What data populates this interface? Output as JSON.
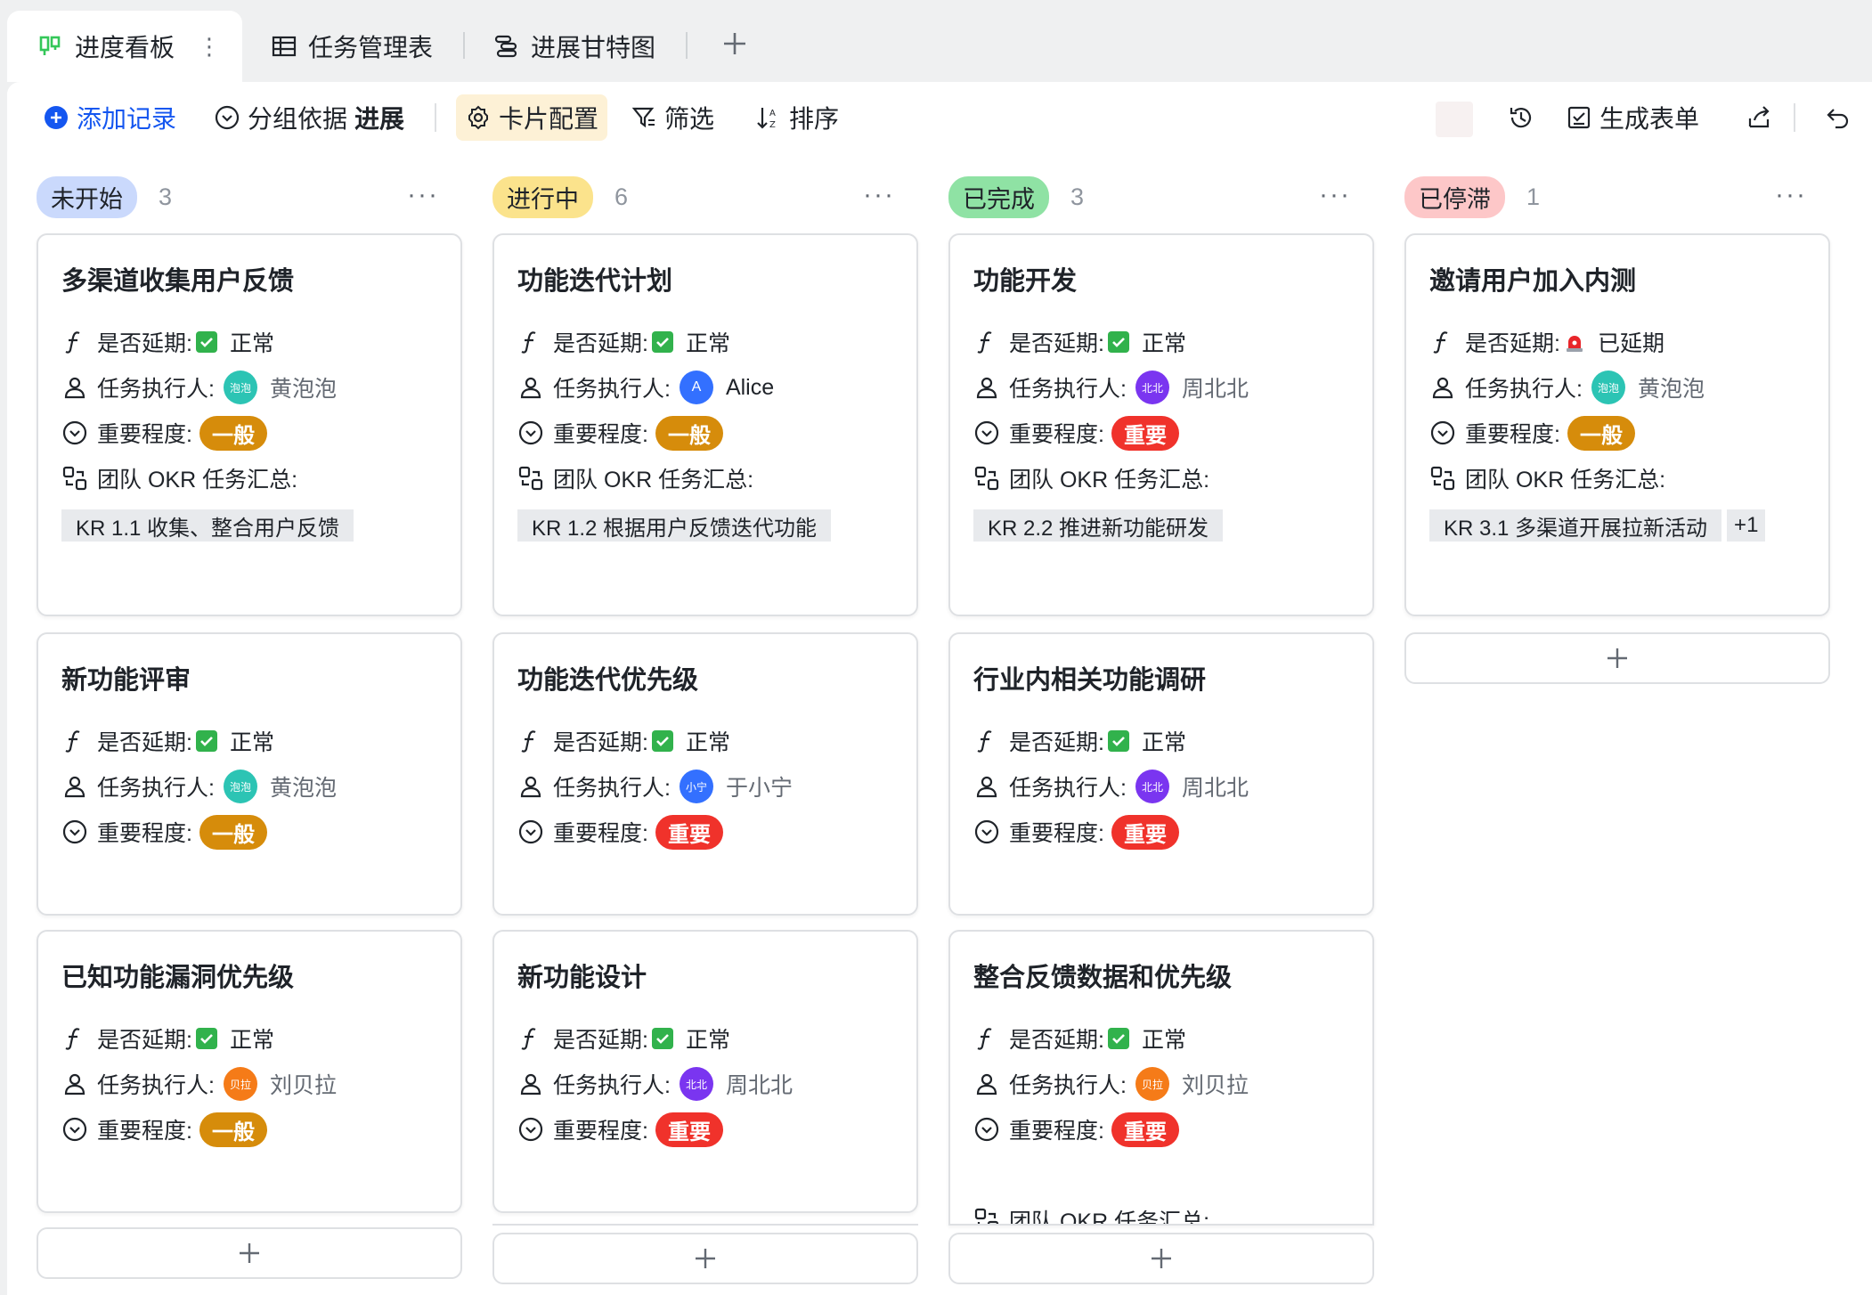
{
  "tabs": [
    {
      "label": "进度看板",
      "icon": "kanban-icon"
    },
    {
      "label": "任务管理表",
      "icon": "table-icon"
    },
    {
      "label": "进展甘特图",
      "icon": "gantt-icon"
    }
  ],
  "toolbar": {
    "add_record": "添加记录",
    "group_prefix": "分组依据",
    "group_field": "进展",
    "card_config": "卡片配置",
    "filter": "筛选",
    "sort": "排序",
    "generate_form": "生成表单"
  },
  "field_labels": {
    "delay": "是否延期:",
    "assignee": "任务执行人:",
    "importance": "重要程度:",
    "okr": "团队 OKR 任务汇总:"
  },
  "colors": {
    "accent": "#1456f0",
    "not_started": "#cad9fc",
    "in_progress": "#fbe38c",
    "done": "#8fe2a4",
    "stalled": "#fdc7c8",
    "importance_normal": "#d68c0b",
    "importance_high": "#f0322b"
  },
  "columns": [
    {
      "status": "未开始",
      "count": "3",
      "cards": [
        {
          "title": "多渠道收集用户反馈",
          "delay": "正常",
          "assignee": "黄泡泡",
          "avatar_text": "泡泡",
          "avatar_color": "#2cc4b4",
          "importance": "一般",
          "okr": [
            "KR 1.1 收集、整合用户反馈"
          ]
        },
        {
          "title": "新功能评审",
          "delay": "正常",
          "assignee": "黄泡泡",
          "avatar_text": "泡泡",
          "avatar_color": "#2cc4b4",
          "importance": "一般"
        },
        {
          "title": "已知功能漏洞优先级",
          "delay": "正常",
          "assignee": "刘贝拉",
          "avatar_text": "贝拉",
          "avatar_color": "#f57b18",
          "importance": "一般"
        }
      ]
    },
    {
      "status": "进行中",
      "count": "6",
      "cards": [
        {
          "title": "功能迭代计划",
          "delay": "正常",
          "assignee": "Alice",
          "avatar_text": "A",
          "avatar_color": "#3370ff",
          "importance": "一般",
          "okr": [
            "KR 1.2 根据用户反馈迭代功能"
          ]
        },
        {
          "title": "功能迭代优先级",
          "delay": "正常",
          "assignee": "于小宁",
          "avatar_text": "小宁",
          "avatar_color": "#3370ff",
          "importance": "重要"
        },
        {
          "title": "新功能设计",
          "delay": "正常",
          "assignee": "周北北",
          "avatar_text": "北北",
          "avatar_color": "#7a35f0",
          "importance": "重要"
        }
      ]
    },
    {
      "status": "已完成",
      "count": "3",
      "cards": [
        {
          "title": "功能开发",
          "delay": "正常",
          "assignee": "周北北",
          "avatar_text": "北北",
          "avatar_color": "#7a35f0",
          "importance": "重要",
          "okr": [
            "KR 2.2 推进新功能研发"
          ]
        },
        {
          "title": "行业内相关功能调研",
          "delay": "正常",
          "assignee": "周北北",
          "avatar_text": "北北",
          "avatar_color": "#7a35f0",
          "importance": "重要"
        },
        {
          "title": "整合反馈数据和优先级",
          "delay": "正常",
          "assignee": "刘贝拉",
          "avatar_text": "贝拉",
          "avatar_color": "#f57b18",
          "importance": "重要",
          "okr_label_partial": "团队 OKR 任务汇总:"
        }
      ]
    },
    {
      "status": "已停滞",
      "count": "1",
      "cards": [
        {
          "title": "邀请用户加入内测",
          "delay": "已延期",
          "assignee": "黄泡泡",
          "avatar_text": "泡泡",
          "avatar_color": "#2cc4b4",
          "importance": "一般",
          "okr": [
            "KR 3.1 多渠道开展拉新活动"
          ],
          "okr_more": "+1"
        }
      ]
    }
  ]
}
